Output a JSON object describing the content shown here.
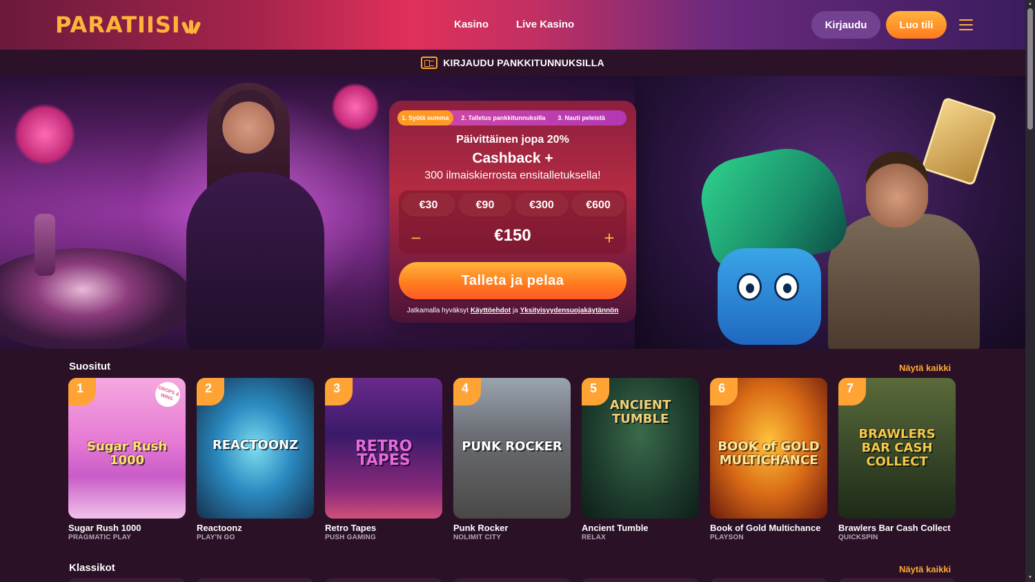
{
  "header": {
    "logo": "PARATIISI",
    "nav": [
      {
        "label": "Kasino"
      },
      {
        "label": "Live Kasino"
      }
    ],
    "login_label": "Kirjaudu",
    "signup_label": "Luo tili"
  },
  "bankbar": {
    "label": "KIRJAUDU PANKKITUNNUKSILLA"
  },
  "deposit": {
    "steps": [
      "1. Syötä summa",
      "2. Talletus pankkitunnuksilla",
      "3. Nauti peleistä"
    ],
    "active_step": 1,
    "offer_line1": "Päivittäinen jopa 20%",
    "offer_line2": "Cashback +",
    "offer_line3": "300 ilmaiskierrosta ensitalletuksella!",
    "amounts": [
      "€30",
      "€90",
      "€300",
      "€600"
    ],
    "current_amount": "€150",
    "minus": "−",
    "plus": "+",
    "cta_label": "Talleta ja pelaa",
    "terms_prefix": "Jatkamalla hyväksyt",
    "terms_link": "Käyttöehdot",
    "terms_and": "ja",
    "privacy_link": "Yksityisyydensuojakäytännön"
  },
  "sections": [
    {
      "title": "Suositut",
      "link": "Näytä kaikki"
    },
    {
      "title": "Klassikot",
      "link": "Näytä kaikki"
    }
  ],
  "games": [
    {
      "rank": "1",
      "art": "Sugar Rush 1000",
      "title": "Sugar Rush 1000",
      "provider": "PRAGMATIC PLAY",
      "badge": "DROPS & WINS"
    },
    {
      "rank": "2",
      "art": "REACTOONZ",
      "title": "Reactoonz",
      "provider": "PLAY'N GO"
    },
    {
      "rank": "3",
      "art": "RETRO TAPES",
      "title": "Retro Tapes",
      "provider": "PUSH GAMING"
    },
    {
      "rank": "4",
      "art": "PUNK ROCKER",
      "title": "Punk Rocker",
      "provider": "NOLIMIT CITY"
    },
    {
      "rank": "5",
      "art": "ANCIENT TUMBLE",
      "title": "Ancient Tumble",
      "provider": "RELAX"
    },
    {
      "rank": "6",
      "art": "BOOK of GOLD MULTICHANCE",
      "title": "Book of Gold Multichance",
      "provider": "PLAYSON"
    },
    {
      "rank": "7",
      "art": "BRAWLERS BAR CASH COLLECT",
      "title": "Brawlers Bar Cash Collect",
      "provider": "QUICKSPIN"
    }
  ],
  "colors": {
    "accent": "#ffa335",
    "background": "#2a1126",
    "cta": "#ff8a24"
  }
}
